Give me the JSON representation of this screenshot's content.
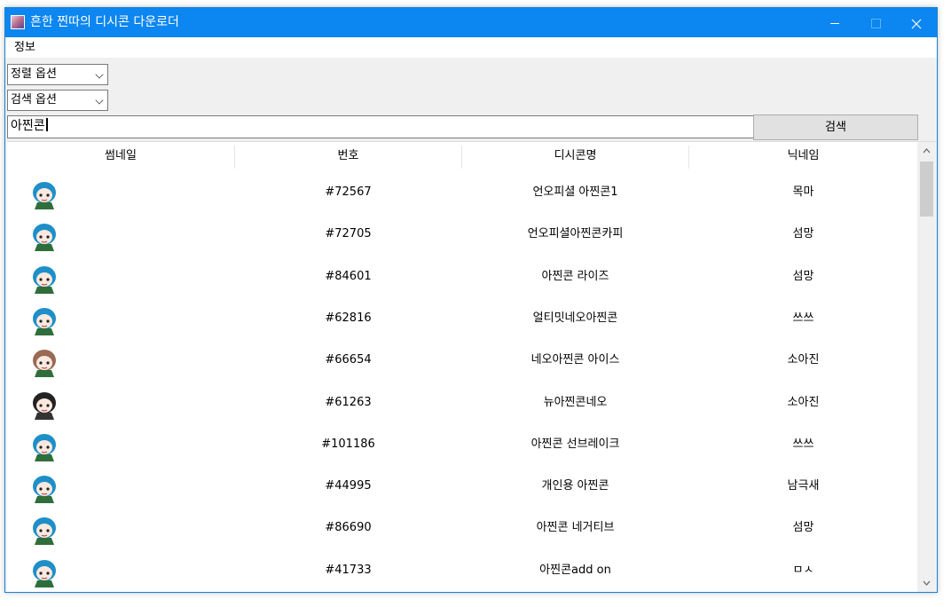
{
  "window": {
    "title": "흔한 찐따의 디시콘 다운로더"
  },
  "menu": {
    "info": "정보"
  },
  "sort_combo": {
    "value": "정렬 옵션"
  },
  "search_combo": {
    "value": "검색 옵션"
  },
  "search": {
    "value": "아찐콘",
    "button_label": "검색"
  },
  "table": {
    "columns": [
      "썸네일",
      "번호",
      "디시콘명",
      "닉네임"
    ],
    "rows": [
      {
        "number": "#72567",
        "name": "언오피셜 아찐콘1",
        "nick": "목마",
        "thumb": "hair-blue"
      },
      {
        "number": "#72705",
        "name": "언오피셜아찐콘카피",
        "nick": "섬망",
        "thumb": "hair-blue"
      },
      {
        "number": "#84601",
        "name": "아찐콘 라이즈",
        "nick": "섬망",
        "thumb": "hair-blue"
      },
      {
        "number": "#62816",
        "name": "얼티밋네오아찐콘",
        "nick": "쓰쓰",
        "thumb": "hair-blue"
      },
      {
        "number": "#66654",
        "name": "네오아찐콘 아이스",
        "nick": "소아진",
        "thumb": "hair-brown"
      },
      {
        "number": "#61263",
        "name": "뉴아찐콘네오",
        "nick": "소아진",
        "thumb": "hair-black"
      },
      {
        "number": "#101186",
        "name": "아찐콘 선브레이크",
        "nick": "쓰쓰",
        "thumb": "hair-blue"
      },
      {
        "number": "#44995",
        "name": "개인용 아찐콘",
        "nick": "남극새",
        "thumb": "hair-blue"
      },
      {
        "number": "#86690",
        "name": "아찐콘 네거티브",
        "nick": "섬망",
        "thumb": "hair-blue"
      },
      {
        "number": "#41733",
        "name": "아찐콘add on",
        "nick": "ㅁㅅ",
        "thumb": "hair-blue"
      }
    ]
  },
  "colors": {
    "titlebar": "#0c86f0",
    "hair-blue": "#1e8fc8",
    "hair-brown": "#9a6a55",
    "hair-black": "#222222"
  }
}
